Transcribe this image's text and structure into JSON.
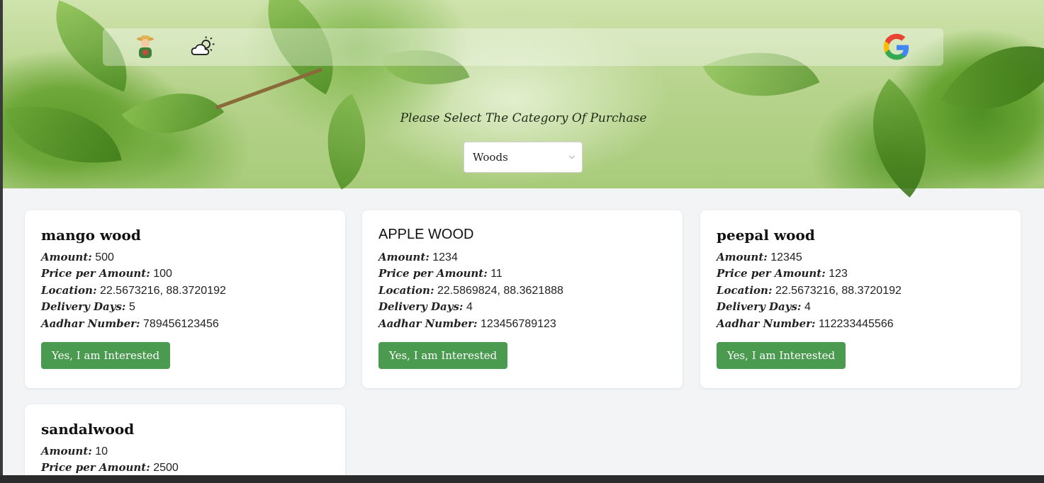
{
  "header": {
    "farmer_icon": "farmer-icon",
    "weather_icon": "weather-icon",
    "google_icon": "google-icon",
    "prompt": "Please Select The Category Of Purchase",
    "category_select": {
      "selected": "Woods"
    }
  },
  "labels": {
    "amount": "Amount:",
    "price": "Price per Amount:",
    "location": "Location:",
    "delivery": "Delivery Days:",
    "aadhar": "Aadhar Number:",
    "button": "Yes, I am Interested"
  },
  "products": [
    {
      "name": "mango wood",
      "amount": "500",
      "price": "100",
      "location": "22.5673216, 88.3720192",
      "delivery": "5",
      "aadhar": "789456123456"
    },
    {
      "name": "APPLE WOOD",
      "amount": "1234",
      "price": "11",
      "location": "22.5869824, 88.3621888",
      "delivery": "4",
      "aadhar": "123456789123"
    },
    {
      "name": "peepal wood",
      "amount": "12345",
      "price": "123",
      "location": "22.5673216, 88.3720192",
      "delivery": "4",
      "aadhar": "112233445566"
    },
    {
      "name": "sandalwood",
      "amount": "10",
      "price": "2500"
    }
  ],
  "colors": {
    "button": "#4a9a4f",
    "page_bg": "#f3f4f6"
  }
}
